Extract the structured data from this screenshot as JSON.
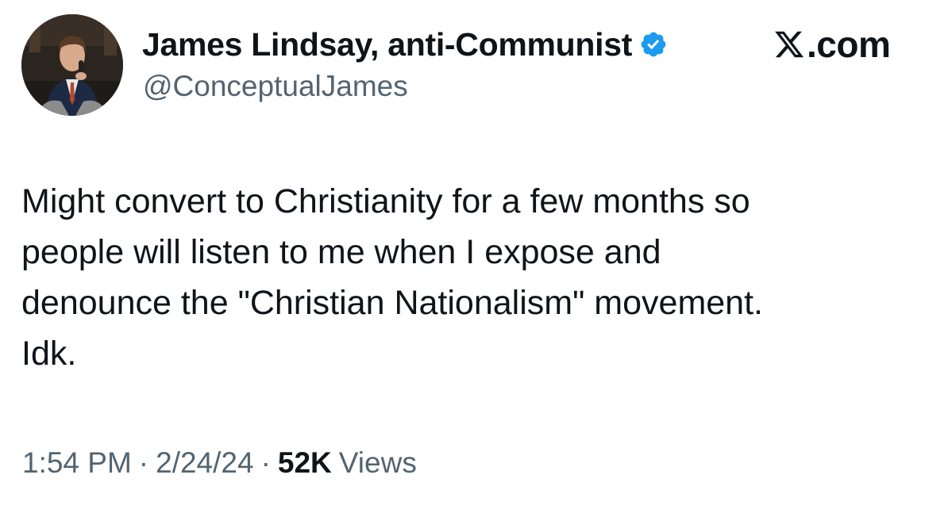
{
  "author": {
    "display_name": "James Lindsay, anti-Communist",
    "handle": "@ConceptualJames",
    "verified": true,
    "verified_badge_color": "#1d9bf0",
    "avatar_icon": "profile-photo"
  },
  "brand": {
    "label": ".com",
    "icon": "x-logo-icon"
  },
  "tweet": {
    "text": "Might convert to Christianity for a few months so\npeople will listen to me when I expose and\ndenounce the \"Christian Nationalism\" movement.\nIdk."
  },
  "meta": {
    "time": "1:54 PM",
    "separator": "·",
    "date": "2/24/24",
    "views_count": "52K",
    "views_label": "Views"
  },
  "colors": {
    "text_primary": "#0f1419",
    "text_secondary": "#536471",
    "background": "#ffffff"
  }
}
